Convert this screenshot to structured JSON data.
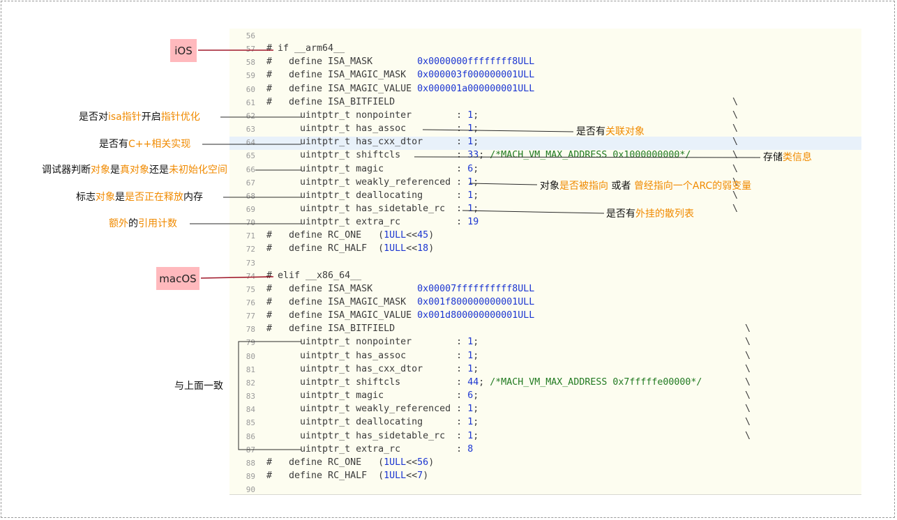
{
  "code": {
    "lines": [
      {
        "n": "56",
        "t": ""
      },
      {
        "n": "57",
        "t": "# if __arm64__"
      },
      {
        "n": "58",
        "t": "#   define ISA_MASK        ",
        "v": "0x0000000ffffffff8ULL"
      },
      {
        "n": "59",
        "t": "#   define ISA_MAGIC_MASK  ",
        "v": "0x000003f000000001ULL"
      },
      {
        "n": "60",
        "t": "#   define ISA_MAGIC_VALUE ",
        "v": "0x000001a000000001ULL"
      },
      {
        "n": "61",
        "t": "#   define ISA_BITFIELD"
      },
      {
        "n": "62",
        "t": "      uintptr_t nonpointer        : ",
        "v": "1",
        "s": ";"
      },
      {
        "n": "63",
        "t": "      uintptr_t has_assoc         : ",
        "v": "1",
        "s": ";"
      },
      {
        "n": "64",
        "t": "      uintptr_t has_cxx_dtor      : ",
        "v": "1",
        "s": ";"
      },
      {
        "n": "65",
        "t": "      uintptr_t shiftcls          : ",
        "v": "33",
        "s": "; ",
        "c": "/*MACH_VM_MAX_ADDRESS 0x1000000000*/"
      },
      {
        "n": "66",
        "t": "      uintptr_t magic             : ",
        "v": "6",
        "s": ";"
      },
      {
        "n": "67",
        "t": "      uintptr_t weakly_referenced : ",
        "v": "1",
        "s": ";"
      },
      {
        "n": "68",
        "t": "      uintptr_t deallocating      : ",
        "v": "1",
        "s": ";"
      },
      {
        "n": "69",
        "t": "      uintptr_t has_sidetable_rc  : ",
        "v": "1",
        "s": ";"
      },
      {
        "n": "70",
        "t": "      uintptr_t extra_rc          : ",
        "v": "19"
      },
      {
        "n": "71",
        "t": "#   define RC_ONE   (",
        "v": "1ULL",
        "s": "<<",
        "v2": "45",
        "e": ")"
      },
      {
        "n": "72",
        "t": "#   define RC_HALF  (",
        "v": "1ULL",
        "s": "<<",
        "v2": "18",
        "e": ")"
      },
      {
        "n": "73",
        "t": ""
      },
      {
        "n": "74",
        "t": "# elif __x86_64__"
      },
      {
        "n": "75",
        "t": "#   define ISA_MASK        ",
        "v": "0x00007ffffffffff8ULL"
      },
      {
        "n": "76",
        "t": "#   define ISA_MAGIC_MASK  ",
        "v": "0x001f800000000001ULL"
      },
      {
        "n": "77",
        "t": "#   define ISA_MAGIC_VALUE ",
        "v": "0x001d800000000001ULL"
      },
      {
        "n": "78",
        "t": "#   define ISA_BITFIELD"
      },
      {
        "n": "79",
        "t": "      uintptr_t nonpointer        : ",
        "v": "1",
        "s": ";"
      },
      {
        "n": "80",
        "t": "      uintptr_t has_assoc         : ",
        "v": "1",
        "s": ";"
      },
      {
        "n": "81",
        "t": "      uintptr_t has_cxx_dtor      : ",
        "v": "1",
        "s": ";"
      },
      {
        "n": "82",
        "t": "      uintptr_t shiftcls          : ",
        "v": "44",
        "s": "; ",
        "c": "/*MACH_VM_MAX_ADDRESS 0x7fffffe00000*/"
      },
      {
        "n": "83",
        "t": "      uintptr_t magic             : ",
        "v": "6",
        "s": ";"
      },
      {
        "n": "84",
        "t": "      uintptr_t weakly_referenced : ",
        "v": "1",
        "s": ";"
      },
      {
        "n": "85",
        "t": "      uintptr_t deallocating      : ",
        "v": "1",
        "s": ";"
      },
      {
        "n": "86",
        "t": "      uintptr_t has_sidetable_rc  : ",
        "v": "1",
        "s": ";"
      },
      {
        "n": "87",
        "t": "      uintptr_t extra_rc          : ",
        "v": "8"
      },
      {
        "n": "88",
        "t": "#   define RC_ONE   (",
        "v": "1ULL",
        "s": "<<",
        "v2": "56",
        "e": ")"
      },
      {
        "n": "89",
        "t": "#   define RC_HALF  (",
        "v": "1ULL",
        "s": "<<",
        "v2": "7",
        "e": ")"
      },
      {
        "n": "90",
        "t": ""
      }
    ],
    "backslash": "\\",
    "highlighted_line": "64"
  },
  "badges": {
    "ios": "iOS",
    "macos": "macOS"
  },
  "annotations": {
    "nonpointer": [
      {
        "t": "是否对"
      },
      {
        "t": "isa指针",
        "o": true
      },
      {
        "t": "开启"
      },
      {
        "t": "指针优化",
        "o": true
      }
    ],
    "has_assoc": [
      {
        "t": "是否有"
      },
      {
        "t": "关联对象",
        "o": true
      }
    ],
    "has_cxx_dtor": [
      {
        "t": "是否有"
      },
      {
        "t": "C++相关实现",
        "o": true
      }
    ],
    "shiftcls": [
      {
        "t": "存储"
      },
      {
        "t": "类信息",
        "o": true
      }
    ],
    "magic": [
      {
        "t": "调试器判断"
      },
      {
        "t": "对象",
        "o": true
      },
      {
        "t": "是"
      },
      {
        "t": "真对象",
        "o": true
      },
      {
        "t": "还是"
      },
      {
        "t": "未初始化空间",
        "o": true
      }
    ],
    "weakly_referenced": [
      {
        "t": "对象"
      },
      {
        "t": "是否被指向",
        "o": true
      },
      {
        "t": " 或者 "
      },
      {
        "t": "曾经指向一个ARC的弱变量",
        "o": true
      }
    ],
    "deallocating": [
      {
        "t": "标志"
      },
      {
        "t": "对象",
        "o": true
      },
      {
        "t": "是"
      },
      {
        "t": "是否正在释放",
        "o": true
      },
      {
        "t": "内存"
      }
    ],
    "has_sidetable_rc": [
      {
        "t": "是否有"
      },
      {
        "t": "外挂的散列表",
        "o": true
      }
    ],
    "extra_rc": [
      {
        "t": "额外",
        "o": true
      },
      {
        "t": "的"
      },
      {
        "t": "引用计数",
        "o": true
      }
    ],
    "same_as_above": [
      {
        "t": "与上面一致"
      }
    ]
  },
  "colors": {
    "orange": "#f08a00",
    "number": "#1b35d1",
    "comment": "#217a21",
    "badge_bg": "#ffb9bd",
    "arrow_red": "#a0182a"
  }
}
